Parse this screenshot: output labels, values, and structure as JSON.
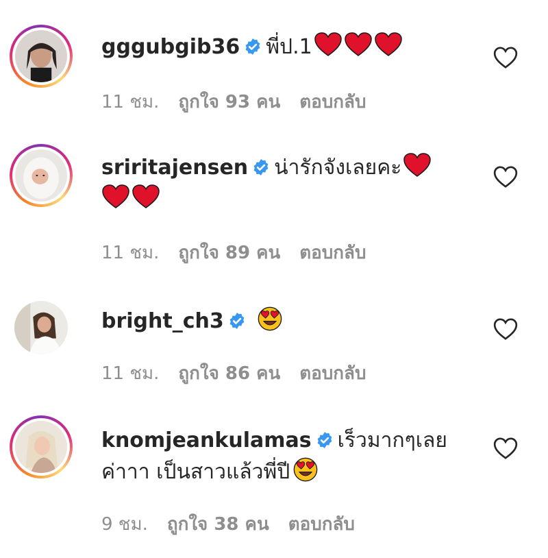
{
  "comments": [
    {
      "username": "gggubgib36",
      "text": "พี่ป.1",
      "emojis": [
        "red-heart",
        "red-heart",
        "red-heart"
      ],
      "time": "11 ชม.",
      "likes": "ถูกใจ 93 คน",
      "reply": "ตอบกลับ"
    },
    {
      "username": "sriritajensen",
      "text": "น่ารักจังเลยคะ",
      "emojis": [
        "red-heart",
        "red-heart",
        "red-heart"
      ],
      "time": "11 ชม.",
      "likes": "ถูกใจ 89 คน",
      "reply": "ตอบกลับ"
    },
    {
      "username": "bright_ch3",
      "text": "",
      "emojis": [
        "heart-eyes"
      ],
      "time": "11 ชม.",
      "likes": "ถูกใจ 86 คน",
      "reply": "ตอบกลับ"
    },
    {
      "username": "knomjeankulamas",
      "text_line1": "เร็วมากๆเลย",
      "text_line2": "ค่าาา เป็นสาวแล้วพี่ปี",
      "emojis": [
        "heart-eyes"
      ],
      "time": "9 ชม.",
      "likes": "ถูกใจ 38 คน",
      "reply": "ตอบกลับ"
    }
  ],
  "colors": {
    "text": "#262626",
    "meta": "#8e8e8e",
    "verified": "#3897f0",
    "heart": "#e0112b"
  }
}
